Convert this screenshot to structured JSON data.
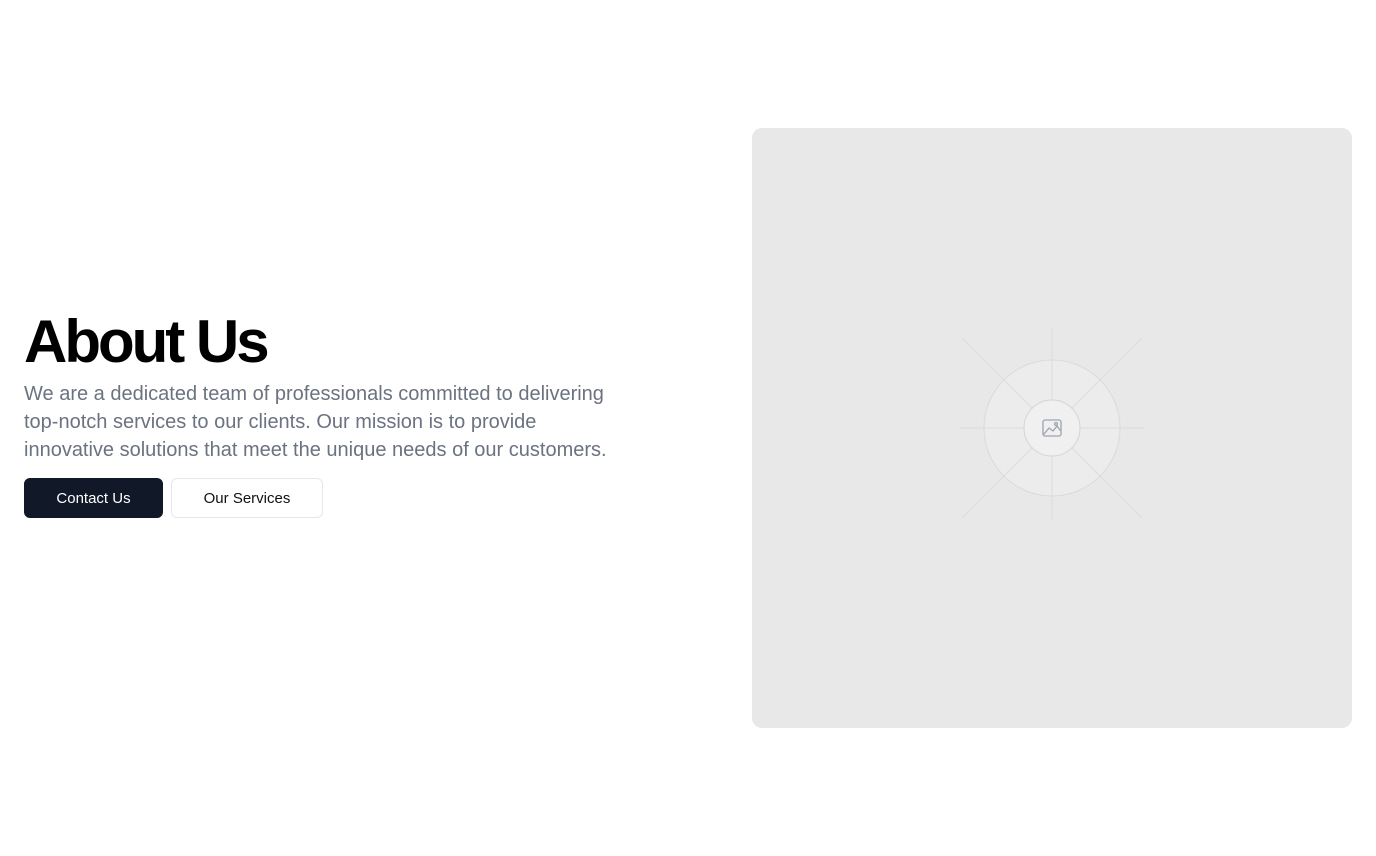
{
  "about": {
    "title": "About Us",
    "description": "We are a dedicated team of professionals committed to delivering top-notch services to our clients. Our mission is to provide innovative solutions that meet the unique needs of our customers."
  },
  "buttons": {
    "contact_label": "Contact Us",
    "services_label": "Our Services"
  },
  "image": {
    "icon": "image-icon"
  },
  "colors": {
    "primary_button": "#111827",
    "text_muted": "#6b7280",
    "placeholder_bg": "#e8e8e8"
  }
}
